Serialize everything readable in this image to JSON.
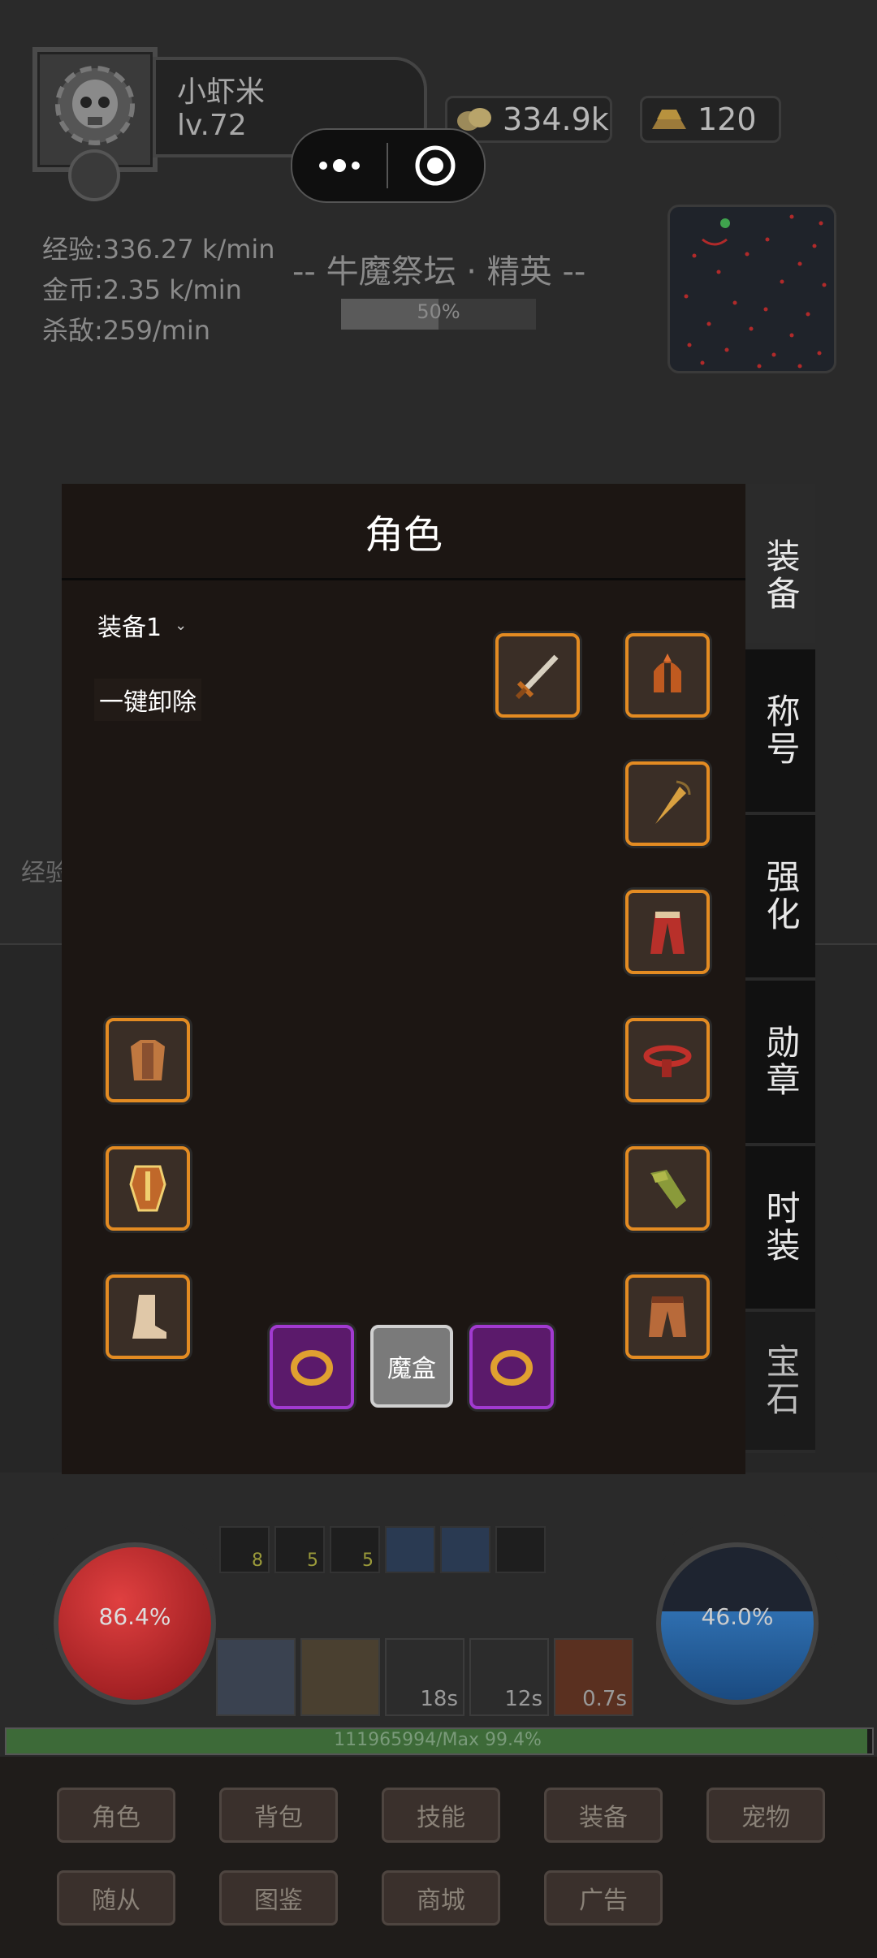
{
  "player": {
    "name": "小虾米",
    "level": "lv.72"
  },
  "currency": {
    "gold": "334.9k",
    "bars": "120"
  },
  "stats": {
    "exp": "经验:336.27 k/min",
    "gold": "金币:2.35 k/min",
    "kills": "杀敌:259/min"
  },
  "map": {
    "title": "-- 牛魔祭坛 · 精英 --",
    "progress_label": "50%",
    "progress": 0.5
  },
  "behind_text": "经验",
  "modal": {
    "title": "角色",
    "loadout": "装备1",
    "unequip_all": "一键卸除",
    "magic_box": "魔盒",
    "tabs": [
      "装备",
      "称号",
      "强化",
      "勋章",
      "时装",
      "宝石"
    ]
  },
  "slots": {
    "weapon": "sword-icon",
    "helmet": "helmet-icon",
    "amulet": "amulet-icon",
    "cape": "cape-icon",
    "belt": "belt-icon",
    "bracer": "bracer-icon",
    "pants": "pants-icon",
    "armor": "armor-icon",
    "shield": "shield-icon",
    "boots": "boots-icon",
    "ring_left": "ring-icon",
    "ring_right": "ring-icon"
  },
  "combat": {
    "hp_percent": "86.4%",
    "mp_percent": "46.0%",
    "buffs": [
      "8",
      "5",
      "5",
      "",
      "",
      ""
    ],
    "cooldowns": [
      "",
      "",
      "18s",
      "12s",
      "0.7s"
    ],
    "exp_bar_text": "111965994/Max    99.4%",
    "exp_fill": 0.994
  },
  "menu": {
    "row1": [
      "角色",
      "背包",
      "技能",
      "装备",
      "宠物"
    ],
    "row2": [
      "随从",
      "图鉴",
      "商城",
      "广告"
    ]
  },
  "colors": {
    "slot_border": "#e38b22",
    "ring_border": "#a13ad0",
    "hp": "#c0242a",
    "mp": "#2f6fb0",
    "modal_bg": "#1c1613"
  }
}
